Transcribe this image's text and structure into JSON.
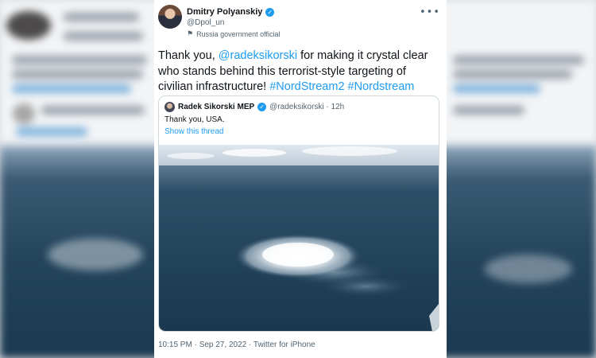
{
  "tweet": {
    "author_name": "Dmitry Polyanskiy",
    "author_handle": "@Dpol_un",
    "label_icon": "flag-icon",
    "label": "Russia government official",
    "more_icon": "more-horizontal-icon",
    "text": {
      "part1": "Thank you, ",
      "mention": "@radeksikorski",
      "part2": " for making it crystal clear who stands behind this terrorist-style targeting of civilian infrastructure! ",
      "hashtag1": "#NordStream2",
      "space": " ",
      "hashtag2": "#Nordstream"
    },
    "timestamp": "10:15 PM · Sep 27, 2022 · Twitter for iPhone"
  },
  "quote": {
    "author_name": "Radek Sikorski MEP",
    "author_handle": "@radeksikorski · 12h",
    "text": "Thank you, USA.",
    "show_thread": "Show this thread"
  },
  "colors": {
    "link": "#1d9bf0",
    "verified": "#1d9bf0",
    "sea": "#24445c"
  }
}
